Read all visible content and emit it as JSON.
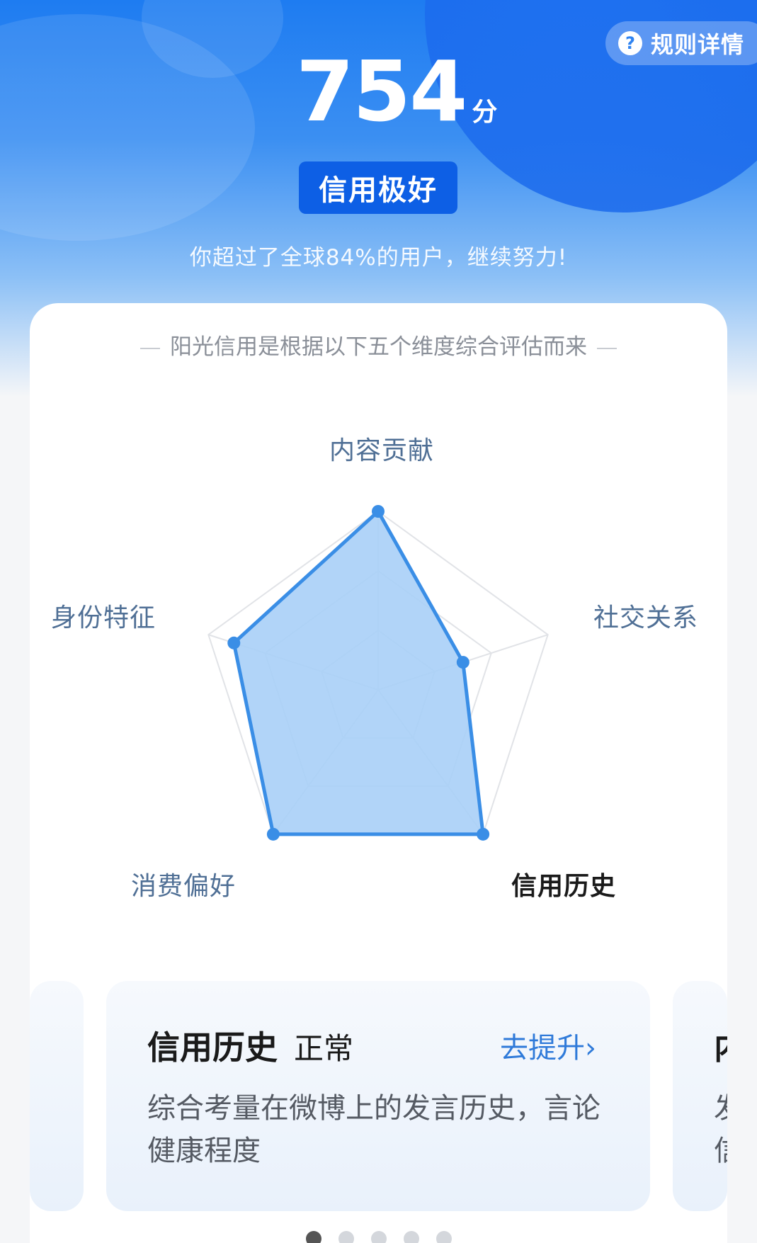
{
  "header": {
    "rules_label": "规则详情",
    "score": "754",
    "score_unit": "分",
    "level_badge": "信用极好",
    "subtitle": "你超过了全球84%的用户，继续努力!"
  },
  "card": {
    "description": "阳光信用是根据以下五个维度综合评估而来"
  },
  "radar": {
    "axes": [
      "内容贡献",
      "社交关系",
      "信用历史",
      "消费偏好",
      "身份特征"
    ],
    "active_axis": "信用历史",
    "values": [
      1.0,
      0.5,
      1.0,
      1.0,
      0.85
    ],
    "fill_color": "#a9cff7",
    "stroke_color": "#3a8ee6"
  },
  "dimension_card": {
    "title": "信用历史",
    "status": "正常",
    "action": "去提升",
    "description": "综合考量在微博上的发言历史，言论健康程度"
  },
  "next_card": {
    "title_peek": "内",
    "desc_line1_peek": "发",
    "desc_line2_peek": "信"
  },
  "pagination": {
    "total": 5,
    "active": 0
  }
}
